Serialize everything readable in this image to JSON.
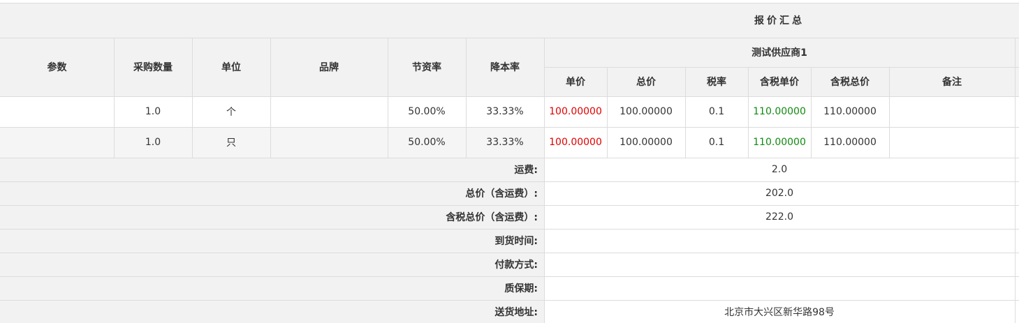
{
  "header": {
    "summary_title": "报价汇总",
    "supplier_name": "测试供应商1",
    "columns": {
      "param": "参数",
      "quantity": "采购数量",
      "unit": "单位",
      "brand": "品牌",
      "saving_rate": "节资率",
      "cost_reduction_rate": "降本率"
    },
    "quote_columns": {
      "unit_price": "单价",
      "total_price": "总价",
      "tax_rate": "税率",
      "tax_unit_price": "含税单价",
      "tax_total_price": "含税总价",
      "remark": "备注"
    }
  },
  "rows": [
    {
      "param": "",
      "quantity": "1.0",
      "unit": "个",
      "brand": "",
      "saving_rate": "50.00%",
      "cost_reduction_rate": "33.33%",
      "unit_price": "100.00000",
      "total_price": "100.00000",
      "tax_rate": "0.1",
      "tax_unit_price": "110.00000",
      "tax_total_price": "110.00000",
      "remark": ""
    },
    {
      "param": "",
      "quantity": "1.0",
      "unit": "只",
      "brand": "",
      "saving_rate": "50.00%",
      "cost_reduction_rate": "33.33%",
      "unit_price": "100.00000",
      "total_price": "100.00000",
      "tax_rate": "0.1",
      "tax_unit_price": "110.00000",
      "tax_total_price": "110.00000",
      "remark": ""
    }
  ],
  "summary": [
    {
      "label": "运费:",
      "value": "2.0"
    },
    {
      "label": "总价（含运费）:",
      "value": "202.0"
    },
    {
      "label": "含税总价（含运费）:",
      "value": "222.0"
    },
    {
      "label": "到货时间:",
      "value": ""
    },
    {
      "label": "付款方式:",
      "value": ""
    },
    {
      "label": "质保期:",
      "value": ""
    },
    {
      "label": "送货地址:",
      "value": "北京市大兴区新华路98号"
    }
  ],
  "colors": {
    "header_bg": "#f2f2f2",
    "stripe_bg": "#f5f5f5",
    "border": "#dcdcdc",
    "unit_price_text": "#e00000",
    "tax_unit_price_text": "#118a11"
  }
}
